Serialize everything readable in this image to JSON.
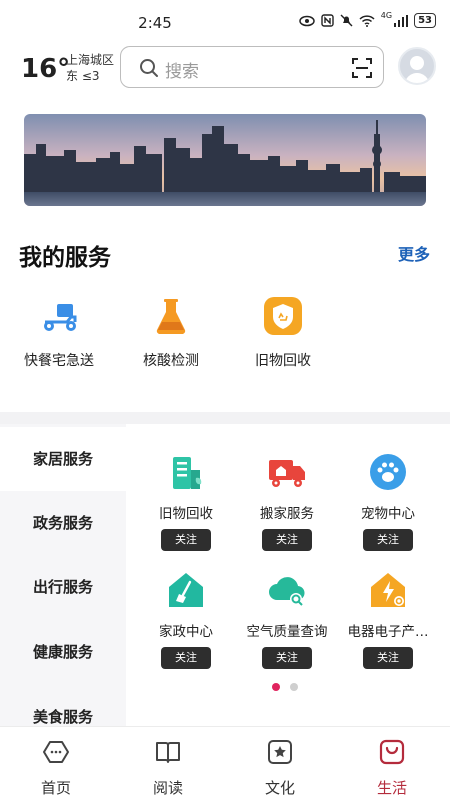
{
  "status_bar": {
    "time": "2:45",
    "network": "4G",
    "battery": "53"
  },
  "header": {
    "temperature": "16°",
    "city": "上海城区",
    "wind": "东 ≤3",
    "search_placeholder": "搜索"
  },
  "my_services": {
    "title": "我的服务",
    "more": "更多",
    "items": [
      {
        "label": "快餐宅急送",
        "icon": "scooter-icon",
        "color": "#3a8ee6"
      },
      {
        "label": "核酸检测",
        "icon": "flask-icon",
        "color": "#f59a23"
      },
      {
        "label": "旧物回收",
        "icon": "recycle-badge-icon",
        "color": "#f5a623"
      }
    ]
  },
  "categories": {
    "items": [
      "家居服务",
      "政务服务",
      "出行服务",
      "健康服务",
      "美食服务"
    ],
    "active": "家居服务"
  },
  "grid": {
    "follow_label": "关注",
    "items": [
      {
        "label": "旧物回收",
        "icon": "building-leaf-icon",
        "color": "#2ec4a6"
      },
      {
        "label": "搬家服务",
        "icon": "moving-truck-icon",
        "color": "#e8453c"
      },
      {
        "label": "宠物中心",
        "icon": "paw-icon",
        "color": "#3a9ee8"
      },
      {
        "label": "家政中心",
        "icon": "house-broom-icon",
        "color": "#22b8a0"
      },
      {
        "label": "空气质量查询",
        "icon": "cloud-search-icon",
        "color": "#26b99a"
      },
      {
        "label": "电器电子产…",
        "icon": "house-bolt-icon",
        "color": "#f5a623"
      }
    ],
    "page_count": 2,
    "current_page": 1
  },
  "tabs": {
    "items": [
      {
        "label": "首页",
        "icon": "home-icon"
      },
      {
        "label": "阅读",
        "icon": "book-icon"
      },
      {
        "label": "文化",
        "icon": "star-frame-icon"
      },
      {
        "label": "生活",
        "icon": "bag-icon"
      }
    ],
    "active": "生活",
    "active_color": "#b42b3c"
  }
}
